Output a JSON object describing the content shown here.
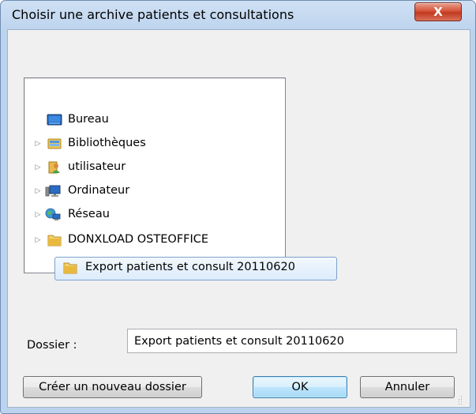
{
  "window": {
    "title": "Choisir une archive patients et consultations",
    "close_label": "X"
  },
  "tree": {
    "items": [
      {
        "label": "Bureau",
        "icon": "desktop-icon",
        "has_expander": false,
        "selected": false
      },
      {
        "label": "Bibliothèques",
        "icon": "libraries-icon",
        "has_expander": true,
        "selected": false
      },
      {
        "label": "utilisateur",
        "icon": "user-folder-icon",
        "has_expander": true,
        "selected": false
      },
      {
        "label": "Ordinateur",
        "icon": "computer-icon",
        "has_expander": true,
        "selected": false
      },
      {
        "label": "Réseau",
        "icon": "network-icon",
        "has_expander": true,
        "selected": false
      },
      {
        "label": "DONXLOAD OSTEOFFICE",
        "icon": "folder-icon",
        "has_expander": true,
        "selected": false
      },
      {
        "label": "Export patients et consult 20110620",
        "icon": "folder-icon",
        "has_expander": false,
        "selected": true
      }
    ]
  },
  "folder_field": {
    "label": "Dossier :",
    "value": "Export patients et consult 20110620"
  },
  "buttons": {
    "new_folder": "Créer un nouveau dossier",
    "ok": "OK",
    "cancel": "Annuler"
  },
  "colors": {
    "title_bar": "#bcd3ee",
    "close_button": "#c23a1f",
    "selection": "#dcebfc",
    "ok_button": "#bee6fd"
  }
}
